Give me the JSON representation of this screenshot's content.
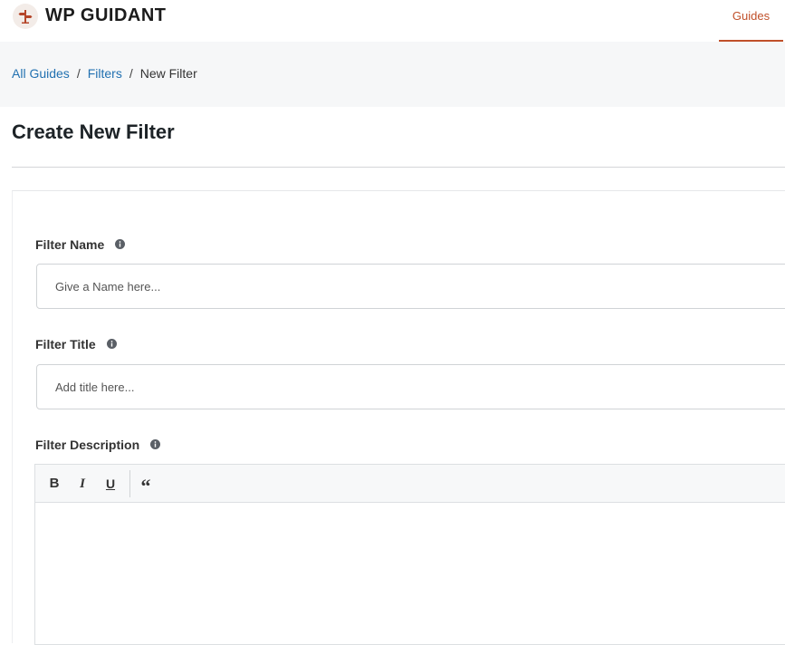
{
  "header": {
    "brand": "WP GUIDANT",
    "nav_guides": "Guides",
    "accent_color": "#c0502a"
  },
  "breadcrumb": {
    "items": [
      "All Guides",
      "Filters",
      "New Filter"
    ],
    "separator": "/"
  },
  "page": {
    "title": "Create New Filter"
  },
  "form": {
    "filter_name": {
      "label": "Filter Name",
      "placeholder": "Give a Name here...",
      "value": ""
    },
    "filter_title": {
      "label": "Filter Title",
      "placeholder": "Add title here...",
      "value": ""
    },
    "filter_description": {
      "label": "Filter Description",
      "toolbar": {
        "bold": "B",
        "italic": "I",
        "underline": "U",
        "quote": "“"
      },
      "content": ""
    }
  }
}
